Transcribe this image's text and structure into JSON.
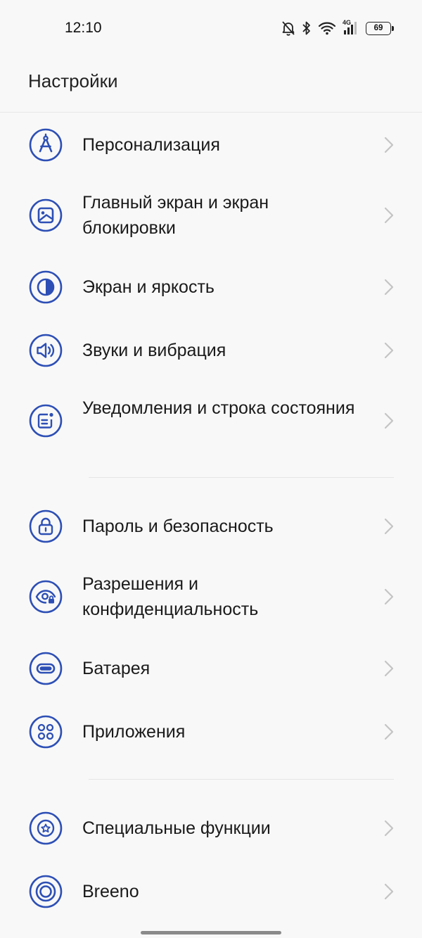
{
  "status_bar": {
    "time": "12:10",
    "network": "4G",
    "battery": "69"
  },
  "header": {
    "title": "Настройки"
  },
  "accent_color": "#2d4fb5",
  "items": [
    {
      "label": "Персонализация",
      "icon": "compass-icon"
    },
    {
      "label": "Главный экран и экран блокировки",
      "icon": "wallpaper-icon"
    },
    {
      "label": "Экран и яркость",
      "icon": "brightness-icon"
    },
    {
      "label": "Звуки и вибрация",
      "icon": "speaker-icon"
    },
    {
      "label": "Уведомления и строка состояния",
      "icon": "notification-icon"
    },
    {
      "label": "Пароль и безопасность",
      "icon": "lock-icon"
    },
    {
      "label": "Разрешения и конфиденциальность",
      "icon": "privacy-eye-icon"
    },
    {
      "label": "Батарея",
      "icon": "battery-icon"
    },
    {
      "label": "Приложения",
      "icon": "apps-grid-icon"
    },
    {
      "label": "Специальные функции",
      "icon": "star-badge-icon"
    },
    {
      "label": "Breeno",
      "icon": "breeno-icon"
    }
  ]
}
